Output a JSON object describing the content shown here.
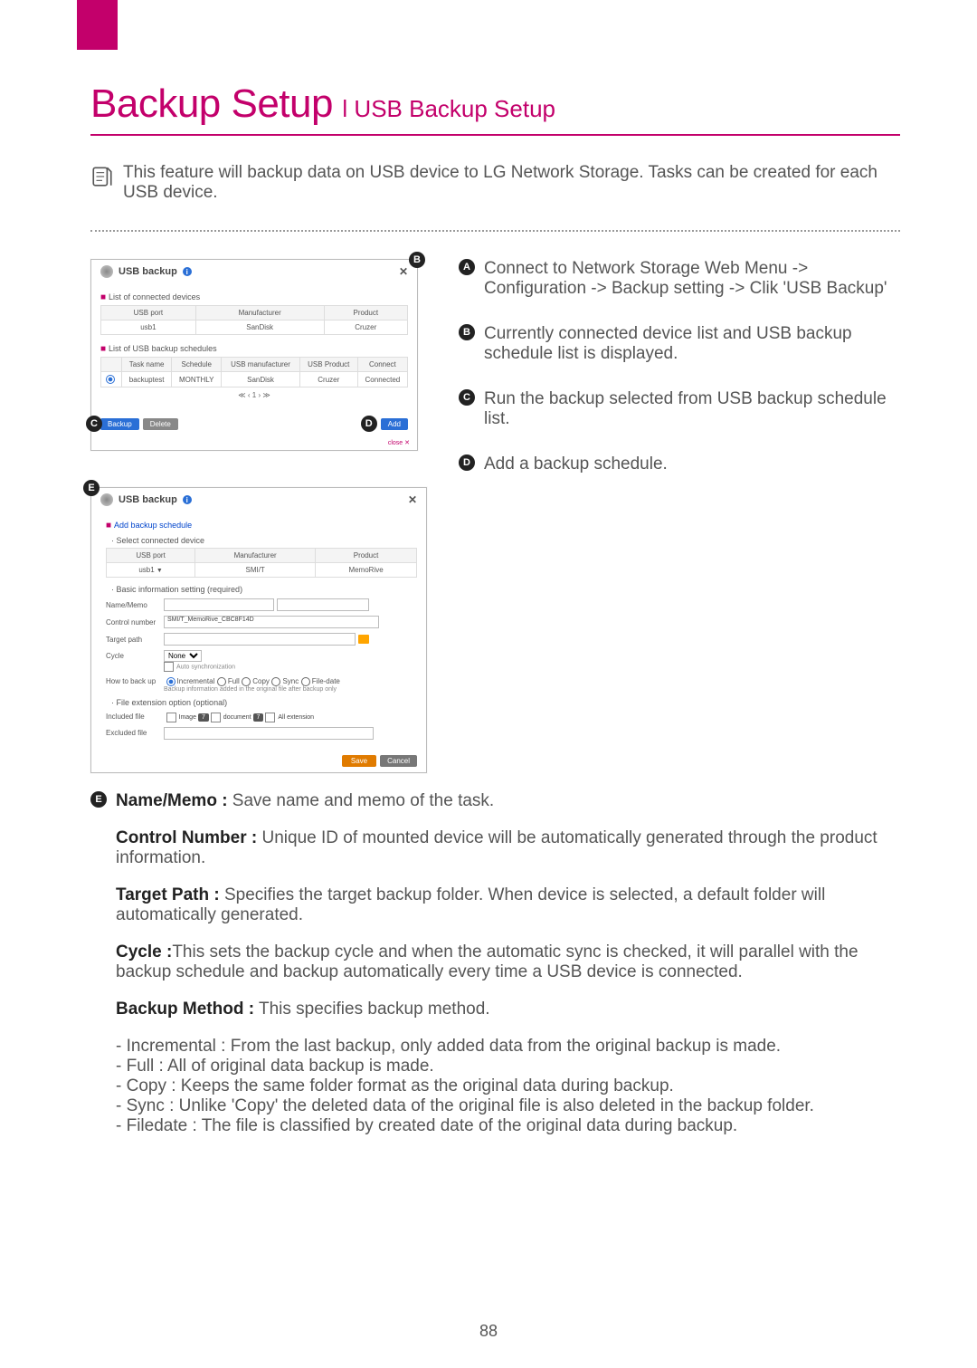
{
  "header": {
    "title_main": "Backup Setup",
    "title_sub": "l USB Backup Setup"
  },
  "intro": "This feature will backup data on USB device to LG Network Storage. Tasks can be created for each USB device.",
  "panel1": {
    "title": "USB backup",
    "sec1": "List of connected devices",
    "t1_headers": {
      "a": "USB port",
      "b": "Manufacturer",
      "c": "Product"
    },
    "t1_row": {
      "a": "usb1",
      "b": "SanDisk",
      "c": "Cruzer"
    },
    "sec2": "List of USB backup schedules",
    "t2_headers": {
      "a": "Task name",
      "b": "Schedule",
      "c": "USB manufacturer",
      "d": "USB Product",
      "e": "Connect"
    },
    "t2_row": {
      "a": "backuptest",
      "b": "MONTHLY",
      "c": "SanDisk",
      "d": "Cruzer",
      "e": "Connected"
    },
    "pager": "≪ ‹ 1 › ≫",
    "btn_backup": "Backup",
    "btn_delete": "Delete",
    "btn_add": "Add"
  },
  "panel2": {
    "title": "USB backup",
    "sec_add": "Add backup schedule",
    "sec_select": "Select connected device",
    "t_headers": {
      "a": "USB port",
      "b": "Manufacturer",
      "c": "Product"
    },
    "t_row": {
      "a": "usb1",
      "b": "SMI/T",
      "c": "MemoRive"
    },
    "sec_basic": "Basic information setting (required)",
    "lbl_name": "Name/Memo",
    "lbl_control": "Control number",
    "val_control": "SMI/T_MemoRive_CBC8F14D",
    "lbl_target": "Target path",
    "lbl_cycle": "Cycle",
    "val_cycle": "None",
    "chk_auto": "Auto synchronization",
    "lbl_howto": "How to back up",
    "r_inc": "Incremental",
    "r_full": "Full",
    "r_copy": "Copy",
    "r_sync": "Sync",
    "r_filedate": "File-date",
    "hint_howto": "Backup information added in the original file after backup only",
    "sec_ext": "File extension option (optional)",
    "lbl_included": "Included file",
    "chip_image": "Image",
    "chip_doc": "document",
    "chk_allext": "All extension",
    "lbl_excluded": "Excluded file",
    "btn_save": "Save",
    "btn_cancel": "Cancel"
  },
  "badges": {
    "a": "A",
    "b": "B",
    "c": "C",
    "d": "D",
    "e": "E"
  },
  "right": {
    "a": "Connect to Network Storage Web Menu -> Configuration -> Backup setting -> Clik 'USB Backup'",
    "b": "Currently connected device list and USB backup schedule list is displayed.",
    "c": "Run the backup selected from USB backup schedule list.",
    "d": "Add a backup schedule."
  },
  "bottom": {
    "name_label": "Name/Memo :",
    "name_text": " Save name and memo of the task.",
    "control_label": "Control Number :",
    "control_text": " Unique ID of mounted device will be automatically generated through the product information.",
    "target_label": "Target Path :",
    "target_text": " Specifies the target backup folder. When device is selected, a default folder will automatically generated.",
    "cycle_label": "Cycle :",
    "cycle_text": "This sets the backup cycle and when the automatic sync is checked, it will parallel with the backup schedule and backup automatically every time a USB device is connected.",
    "method_label": "Backup Method :",
    "method_text": " This specifies backup method.",
    "li1": "- Incremental : From the last backup, only added data from the original backup is made.",
    "li2": "- Full : All of original data backup is made.",
    "li3": "- Copy : Keeps the same folder format as the original data during backup.",
    "li4": "- Sync : Unlike 'Copy' the deleted data of the original file is also deleted in the backup folder.",
    "li5": "- Filedate : The file is classified by created date of the original data during backup."
  },
  "page_number": "88"
}
